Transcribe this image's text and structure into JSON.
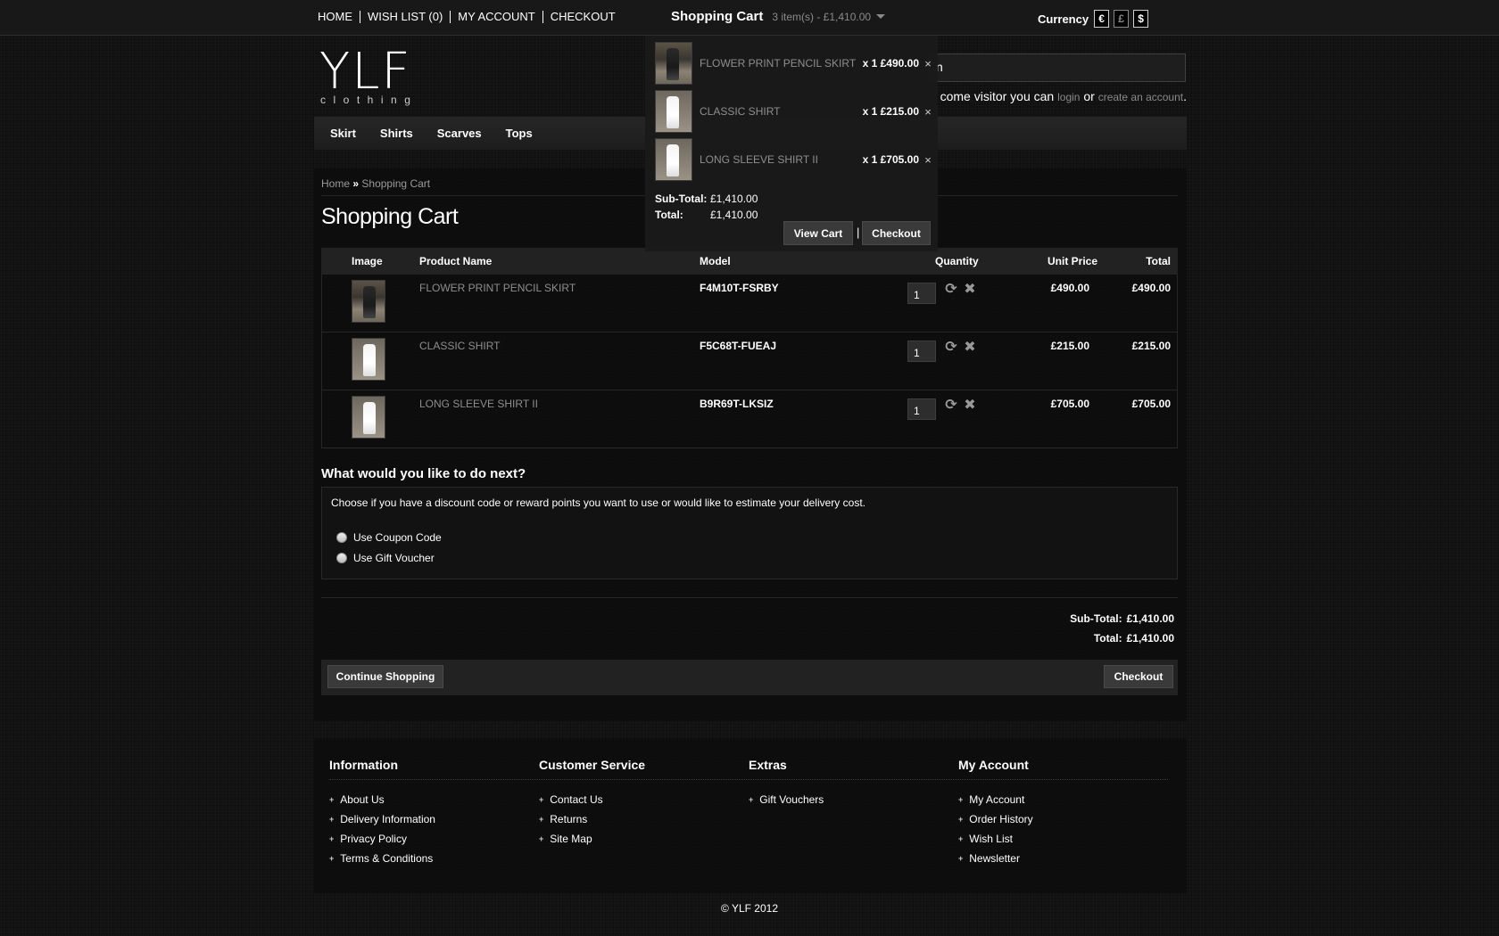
{
  "topnav": {
    "home": "HOME",
    "wishlist": "WISH LIST (0)",
    "account": "MY ACCOUNT",
    "checkout": "CHECKOUT"
  },
  "cart_header": {
    "title": "Shopping Cart",
    "summary": "3 item(s) - £1,410.00"
  },
  "currency": {
    "label": "Currency",
    "options": [
      "€",
      "£",
      "$"
    ]
  },
  "logo": {
    "big": "YLF",
    "small": "clothing"
  },
  "search": {
    "value": "n"
  },
  "welcome": {
    "text": "come visitor you can",
    "login": "login",
    "or": "or",
    "create": "create an account",
    "end": "."
  },
  "menu": [
    "Skirt",
    "Shirts",
    "Scarves",
    "Tops"
  ],
  "breadcrumb": {
    "home": "Home",
    "sep": "»",
    "current": "Shopping Cart"
  },
  "page_title": "Shopping Cart",
  "table": {
    "headers": {
      "image": "Image",
      "name": "Product Name",
      "model": "Model",
      "quantity": "Quantity",
      "unit": "Unit Price",
      "total": "Total"
    },
    "rows": [
      {
        "name": "FLOWER PRINT PENCIL SKIRT",
        "model": "F4M10T-FSRBY",
        "qty": "1",
        "unit": "£490.00",
        "total": "£490.00"
      },
      {
        "name": "CLASSIC SHIRT",
        "model": "F5C68T-FUEAJ",
        "qty": "1",
        "unit": "£215.00",
        "total": "£215.00"
      },
      {
        "name": "LONG SLEEVE SHIRT II",
        "model": "B9R69T-LKSIZ",
        "qty": "1",
        "unit": "£705.00",
        "total": "£705.00"
      }
    ]
  },
  "next": {
    "title": "What would you like to do next?",
    "desc": "Choose if you have a discount code or reward points you want to use or would like to estimate your delivery cost.",
    "opt1": "Use Coupon Code",
    "opt2": "Use Gift Voucher"
  },
  "totals": {
    "subtotal_label": "Sub-Total:",
    "subtotal": "£1,410.00",
    "total_label": "Total:",
    "total": "£1,410.00"
  },
  "buttons": {
    "continue": "Continue Shopping",
    "checkout": "Checkout"
  },
  "dropdown": {
    "items": [
      {
        "name": "FLOWER PRINT PENCIL SKIRT",
        "qp": "x 1 £490.00"
      },
      {
        "name": "CLASSIC SHIRT",
        "qp": "x 1 £215.00"
      },
      {
        "name": "LONG SLEEVE SHIRT II",
        "qp": "x 1 £705.00"
      }
    ],
    "remove": "×",
    "subtotal_label": "Sub-Total:",
    "subtotal": "£1,410.00",
    "total_label": "Total:",
    "total": "£1,410.00",
    "view_cart": "View Cart",
    "sep": "|",
    "checkout": "Checkout"
  },
  "footer": {
    "information": {
      "title": "Information",
      "links": [
        "About Us",
        "Delivery Information",
        "Privacy Policy",
        "Terms & Conditions"
      ]
    },
    "service": {
      "title": "Customer Service",
      "links": [
        "Contact Us",
        "Returns",
        "Site Map"
      ]
    },
    "extras": {
      "title": "Extras",
      "links": [
        "Gift Vouchers"
      ]
    },
    "account": {
      "title": "My Account",
      "links": [
        "My Account",
        "Order History",
        "Wish List",
        "Newsletter"
      ]
    },
    "copyright": "© YLF 2012"
  },
  "icons": {
    "update": "refresh-icon",
    "remove": "remove-icon"
  }
}
